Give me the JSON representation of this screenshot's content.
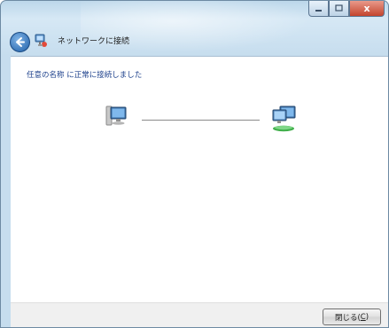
{
  "window": {
    "title": "ネットワークに接続",
    "controls": {
      "close_glyph": "x"
    }
  },
  "content": {
    "status_message": "任意の名称 に正常に接続しました"
  },
  "footer": {
    "close_label": "閉じる(",
    "close_accel": "C",
    "close_suffix": ")"
  },
  "colors": {
    "accent": "#1a3e8a",
    "close_button": "#c3452e"
  },
  "icons": {
    "back": "back-arrow-icon",
    "network": "network-icon",
    "computer": "computer-icon",
    "network_connected": "network-connected-icon"
  }
}
